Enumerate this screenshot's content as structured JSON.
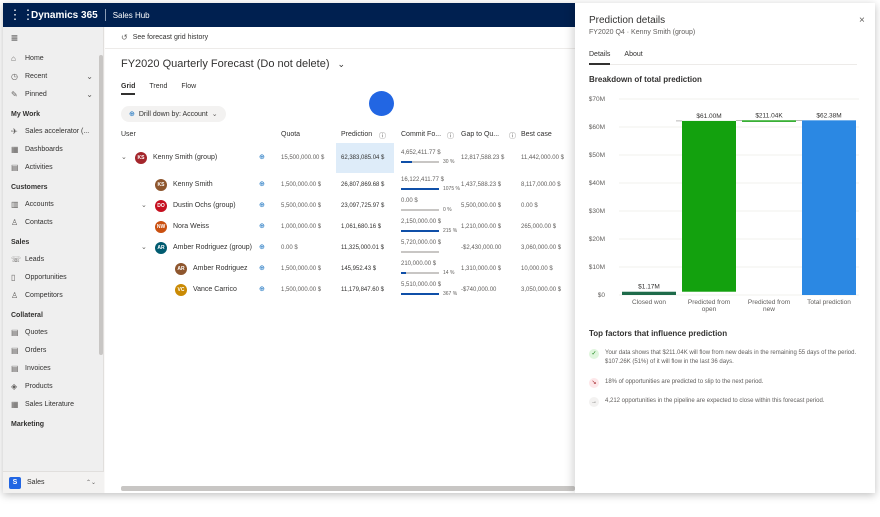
{
  "topbar": {
    "brand": "Dynamics 365",
    "app": "Sales Hub"
  },
  "sidebar": {
    "top": [
      {
        "label": "Home",
        "icon": "home-icon",
        "glyph": "⌂"
      },
      {
        "label": "Recent",
        "icon": "clock-icon",
        "glyph": "◷",
        "chevron": "⌄"
      },
      {
        "label": "Pinned",
        "icon": "pin-icon",
        "glyph": "✎",
        "chevron": "⌄"
      }
    ],
    "groups": [
      {
        "title": "My Work",
        "items": [
          {
            "label": "Sales accelerator (...",
            "icon": "rocket-icon",
            "glyph": "✈"
          },
          {
            "label": "Dashboards",
            "icon": "dashboard-icon",
            "glyph": "▦"
          },
          {
            "label": "Activities",
            "icon": "activities-icon",
            "glyph": "▤"
          }
        ]
      },
      {
        "title": "Customers",
        "items": [
          {
            "label": "Accounts",
            "icon": "building-icon",
            "glyph": "▥"
          },
          {
            "label": "Contacts",
            "icon": "person-icon",
            "glyph": "♙"
          }
        ]
      },
      {
        "title": "Sales",
        "items": [
          {
            "label": "Leads",
            "icon": "phone-icon",
            "glyph": "☏"
          },
          {
            "label": "Opportunities",
            "icon": "opportunity-icon",
            "glyph": "▯"
          },
          {
            "label": "Competitors",
            "icon": "competitor-icon",
            "glyph": "♙"
          }
        ]
      },
      {
        "title": "Collateral",
        "items": [
          {
            "label": "Quotes",
            "icon": "quote-icon",
            "glyph": "▤"
          },
          {
            "label": "Orders",
            "icon": "order-icon",
            "glyph": "▤"
          },
          {
            "label": "Invoices",
            "icon": "invoice-icon",
            "glyph": "▤"
          },
          {
            "label": "Products",
            "icon": "product-icon",
            "glyph": "◈"
          },
          {
            "label": "Sales Literature",
            "icon": "literature-icon",
            "glyph": "▦"
          }
        ]
      },
      {
        "title": "Marketing",
        "items": []
      }
    ],
    "area": {
      "badge": "S",
      "label": "Sales",
      "chevron": "⌃⌄"
    }
  },
  "main": {
    "command": "See forecast grid history",
    "title": "FY2020 Quarterly Forecast (Do not delete)",
    "title_chevron": "⌄",
    "tabs": [
      "Grid",
      "Trend",
      "Flow"
    ],
    "drill": "Drill down by: Account",
    "columns": [
      "User",
      "Quota",
      "Prediction",
      "Commit Fo...",
      "Gap to Qu...",
      "Best case"
    ],
    "rows": [
      {
        "indent": 0,
        "expand": "⌄",
        "initials": "KS",
        "color": "#a4262c",
        "name": "Kenny Smith (group)",
        "quota": "15,500,000.00 $",
        "prediction": "62,383,085.04 $",
        "commit": "4,652,411.77 $",
        "pct": "30 %",
        "fill": 0.3,
        "gap": "12,817,588.23 $",
        "best": "11,442,000.00 $"
      },
      {
        "indent": 1,
        "expand": "",
        "initials": "KS",
        "color": "#8e562e",
        "name": "Kenny Smith",
        "quota": "1,500,000.00 $",
        "prediction": "26,807,869.68 $",
        "commit": "16,122,411.77 $",
        "pct": "1075 %",
        "fill": 1,
        "gap": "1,437,588.23 $",
        "best": "8,117,000.00 $"
      },
      {
        "indent": 1,
        "expand": "⌄",
        "initials": "DO",
        "color": "#c50f1f",
        "name": "Dustin Ochs (group)",
        "quota": "5,500,000.00 $",
        "prediction": "23,097,725.97 $",
        "commit": "0.00 $",
        "pct": "0 %",
        "fill": 0,
        "gap": "5,500,000.00 $",
        "best": "0.00 $"
      },
      {
        "indent": 1,
        "expand": "",
        "initials": "NW",
        "color": "#ca5010",
        "name": "Nora Weiss",
        "quota": "1,000,000.00 $",
        "prediction": "1,061,680.16 $",
        "commit": "2,150,000.00 $",
        "pct": "215 %",
        "fill": 1,
        "gap": "1,210,000.00 $",
        "best": "265,000.00 $"
      },
      {
        "indent": 1,
        "expand": "⌄",
        "initials": "AR",
        "color": "#005b70",
        "name": "Amber Rodriguez (group)",
        "quota": "0.00 $",
        "prediction": "11,325,000.01 $",
        "commit": "5,720,000.00 $",
        "pct": "",
        "fill": 0,
        "gap": "-$2,430,000.00",
        "best": "3,060,000.00 $"
      },
      {
        "indent": 2,
        "expand": "",
        "initials": "AR",
        "color": "#8e562e",
        "name": "Amber Rodriguez",
        "quota": "1,500,000.00 $",
        "prediction": "145,952.43 $",
        "commit": "210,000.00 $",
        "pct": "14 %",
        "fill": 0.14,
        "gap": "1,310,000.00 $",
        "best": "10,000.00 $"
      },
      {
        "indent": 2,
        "expand": "",
        "initials": "VC",
        "color": "#ca8a04",
        "name": "Vance Carrico",
        "quota": "1,500,000.00 $",
        "prediction": "11,179,847.60 $",
        "commit": "5,510,000.00 $",
        "pct": "367 %",
        "fill": 1,
        "gap": "-$740,000.00",
        "best": "3,050,000.00 $"
      }
    ]
  },
  "panel": {
    "title": "Prediction details",
    "subtitle": "FY2020 Q4 · Kenny Smith (group)",
    "close": "×",
    "tabs": [
      "Details",
      "About"
    ],
    "chart_heading": "Breakdown of total prediction",
    "factors_heading": "Top factors that influence prediction",
    "factors": [
      {
        "text": "Your data shows that $211.04K will flow from new deals in the remaining 55 days of the period. $107.26K (51%) of it will flow in the last 36 days.",
        "icon": "check-icon",
        "glyph": "✓",
        "color": "#107c10",
        "bg": "#dff6dd"
      },
      {
        "text": "18% of opportunities are predicted to slip to the next period.",
        "icon": "arrow-down-icon",
        "glyph": "↘",
        "color": "#a4262c",
        "bg": "#fde7e9"
      },
      {
        "text": "4,212 opportunities in the pipeline are expected to close within this forecast period.",
        "icon": "arrow-right-icon",
        "glyph": "→",
        "color": "#605e5c",
        "bg": "#f3f2f1"
      }
    ]
  },
  "chart_data": {
    "type": "bar",
    "title": "Breakdown of total prediction",
    "categories": [
      "Closed won",
      "Predicted from open",
      "Predicted from new",
      "Total prediction"
    ],
    "category_lines": [
      [
        "Closed won"
      ],
      [
        "Predicted from",
        "open"
      ],
      [
        "Predicted from",
        "new"
      ],
      [
        "Total prediction"
      ]
    ],
    "bases": [
      0,
      1.17,
      62.17,
      0
    ],
    "values": [
      1.17,
      61.0,
      0.21104,
      62.38
    ],
    "labels": [
      "$1.17M",
      "$61.00M",
      "$211.04K",
      "$62.38M"
    ],
    "colors": [
      "#1e6b4a",
      "#13a10e",
      "#13a10e",
      "#2b88e3"
    ],
    "ylim": [
      0,
      70
    ],
    "ytick_values": [
      0,
      10,
      20,
      30,
      40,
      50,
      60,
      70
    ],
    "ytick_labels": [
      "$0",
      "$10M",
      "$20M",
      "$30M",
      "$40M",
      "$50M",
      "$60M",
      "$70M"
    ],
    "grid": true
  }
}
